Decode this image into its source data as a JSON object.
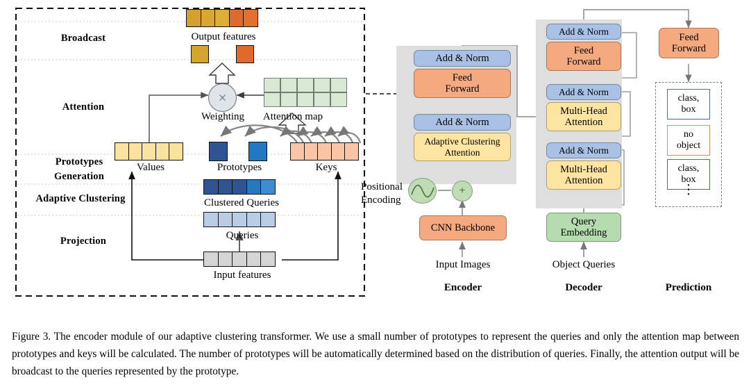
{
  "figure": {
    "caption": "Figure 3. The encoder module of our adaptive clustering transformer. We use a small number of prototypes to represent the queries and only the attention map between prototypes and keys will be calculated. The number of prototypes will be automatically determined based on the distribution of queries. Finally, the attention output will be broadcast to the queries represented by the prototype."
  },
  "left_panel": {
    "stages": [
      {
        "label": "Broadcast"
      },
      {
        "label": "Attention"
      },
      {
        "label": "Prototypes\nGeneration",
        "line1": "Prototypes",
        "line2": "Generation"
      },
      {
        "label": "Adaptive Clustering"
      },
      {
        "label": "Projection"
      }
    ],
    "elements": {
      "output_features": {
        "label": "Output features",
        "cells": [
          "#d4a02c",
          "#d9a72f",
          "#dcae34",
          "#e06a2c",
          "#e2702f"
        ]
      },
      "broadcast_squares": {
        "cells": [
          "#d4a42e",
          "#df6a2b"
        ]
      },
      "weighting": {
        "label": "Weighting",
        "symbol": "×"
      },
      "attention_map": {
        "label": "Attention map",
        "cols": 5,
        "rows": 2,
        "color": "#d9e8d2"
      },
      "values": {
        "label": "Values",
        "cells": [
          "#fbe2a0",
          "#fbe2a0",
          "#fbe2a0",
          "#fbe2a0",
          "#fbe2a0"
        ]
      },
      "prototypes": {
        "label": "Prototypes",
        "cells": [
          "#2d5494",
          "#1f78c4"
        ]
      },
      "keys": {
        "label": "Keys",
        "cells": [
          "#fac4a6",
          "#fac4a6",
          "#fac4a6",
          "#fac4a6",
          "#fac4a6"
        ]
      },
      "clustered_queries": {
        "label": "Clustered Queries",
        "cells": [
          "#2f5494",
          "#2f5494",
          "#2f5494",
          "#2878bf",
          "#3c8ed0"
        ]
      },
      "queries": {
        "label": "Queries",
        "cells": [
          "#b9cde8",
          "#b9cde8",
          "#b9cde8",
          "#b9cde8",
          "#b9cde8"
        ]
      },
      "input_features": {
        "label": "Input features",
        "cells": [
          "#d5d5d5",
          "#d5d5d5",
          "#d5d5d5",
          "#d5d5d5",
          "#d5d5d5"
        ]
      }
    }
  },
  "encoder": {
    "title": "Encoder",
    "input_label": "Input Images",
    "positional_encoding_label": "Positional\nEncoding",
    "pe_line1": "Positional",
    "pe_line2": "Encoding",
    "sum_symbol": "+",
    "blocks": [
      {
        "name": "add-norm-top",
        "label": "Add & Norm",
        "color": "#a8c1e4"
      },
      {
        "name": "feed-forward",
        "label": "Feed\nForward",
        "line1": "Feed",
        "line2": "Forward",
        "color": "#f5a97f"
      },
      {
        "name": "add-norm-bottom",
        "label": "Add & Norm",
        "color": "#a8c1e4"
      },
      {
        "name": "adaptive-clustering-attention",
        "label": "Adaptive Clustering\nAttention",
        "line1": "Adaptive Clustering",
        "line2": "Attention",
        "color": "#fde4a0"
      },
      {
        "name": "cnn-backbone",
        "label": "CNN Backbone",
        "color": "#f5a97f"
      }
    ]
  },
  "decoder": {
    "title": "Decoder",
    "input_label": "Object Queries",
    "blocks": [
      {
        "name": "add-norm-3",
        "label": "Add & Norm",
        "color": "#a8c1e4"
      },
      {
        "name": "feed-forward",
        "label": "Feed\nForward",
        "line1": "Feed",
        "line2": "Forward",
        "color": "#f5a97f"
      },
      {
        "name": "add-norm-2",
        "label": "Add & Norm",
        "color": "#a8c1e4"
      },
      {
        "name": "multi-head-attention-2",
        "label": "Multi-Head\nAttention",
        "line1": "Multi-Head",
        "line2": "Attention",
        "color": "#fde4a0"
      },
      {
        "name": "add-norm-1",
        "label": "Add & Norm",
        "color": "#a8c1e4"
      },
      {
        "name": "multi-head-attention-1",
        "label": "Multi-Head\nAttention",
        "line1": "Multi-Head",
        "line2": "Attention",
        "color": "#fde4a0"
      },
      {
        "name": "query-embedding",
        "label": "Query\nEmbedding",
        "line1": "Query",
        "line2": "Embedding",
        "color": "#b5dcaf"
      }
    ]
  },
  "prediction": {
    "title": "Prediction",
    "feed_forward": {
      "label": "Feed\nForward",
      "line1": "Feed",
      "line2": "Forward",
      "color": "#f5a97f"
    },
    "boxes": [
      {
        "line1": "class,",
        "line2": "box",
        "border": "#4a6fa5"
      },
      {
        "line1": "no",
        "line2": "object",
        "border": "#e08a5d"
      },
      {
        "line1": "class,",
        "line2": "box",
        "border": "#4b7a43"
      }
    ],
    "ellipsis": "⋮"
  }
}
